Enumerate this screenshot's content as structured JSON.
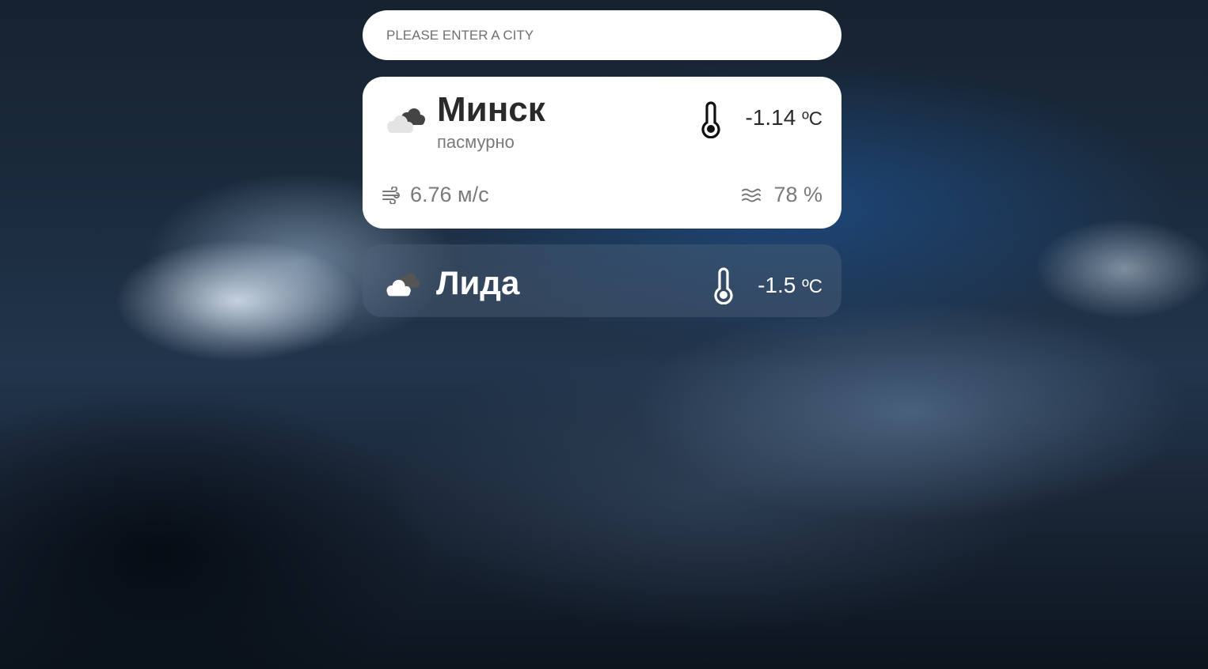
{
  "search": {
    "placeholder": "PLEASE ENTER A CITY",
    "value": ""
  },
  "cards": [
    {
      "city": "Минск",
      "description": "пасмурно",
      "temperature": "-1.14",
      "temp_unit": "ºC",
      "wind": "6.76 м/с",
      "humidity": "78 %",
      "weather_icon": "overcast-cloud-icon",
      "selected": true
    },
    {
      "city": "Лида",
      "temperature": "-1.5",
      "temp_unit": "ºC",
      "weather_icon": "overcast-cloud-icon",
      "selected": false
    }
  ],
  "colors": {
    "card_bg": "#ffffff",
    "text_dark": "#2a2a2a",
    "text_muted": "#7a7a7a",
    "sub_card_bg": "rgba(80,100,125,0.42)"
  }
}
